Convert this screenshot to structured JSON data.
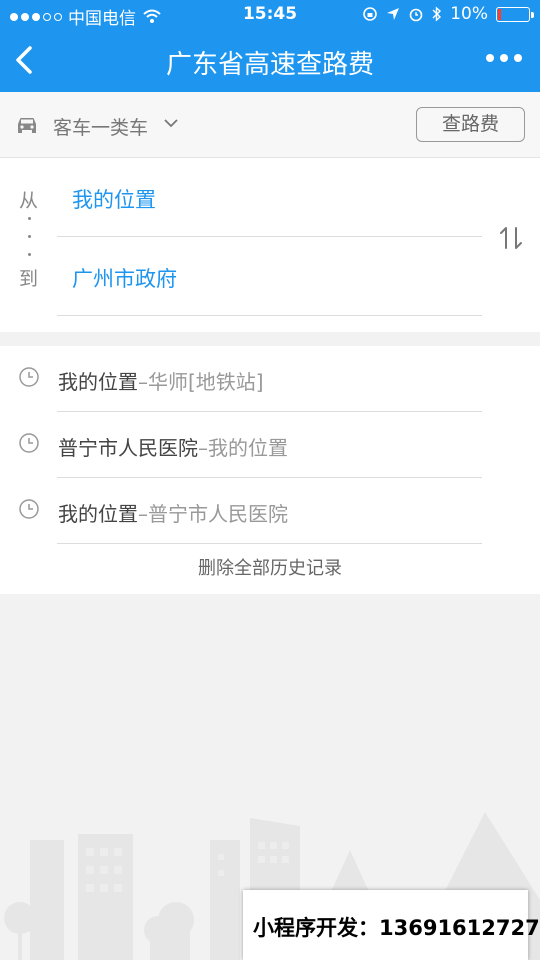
{
  "status_bar": {
    "carrier": "中国电信",
    "time": "15:45",
    "battery": "10%",
    "battery_level": 0.1,
    "signal_dots_filled": 3,
    "signal_dots_total": 5
  },
  "navbar": {
    "title": "广东省高速查路费",
    "background_color": "#1e96f0"
  },
  "vehicle": {
    "type_label": "客车一类车",
    "query_button": "查路费"
  },
  "route": {
    "from_label": "从",
    "to_label": "到",
    "from_value": "我的位置",
    "to_value": "广州市政府",
    "accent_color": "#1e96f0"
  },
  "history": {
    "items": [
      {
        "from": "我的位置",
        "separator": "–",
        "to": "华师[地铁站]"
      },
      {
        "from": "普宁市人民医院",
        "separator": "–",
        "to": "我的位置"
      },
      {
        "from": "我的位置",
        "separator": "–",
        "to": "普宁市人民医院"
      }
    ],
    "clear_label": "删除全部历史记录"
  },
  "watermark": {
    "text": "小程序开发：13691612727"
  },
  "icons": {
    "back": "chevron-left-icon",
    "more": "more-dots-icon",
    "car": "car-icon",
    "dropdown": "chevron-down-icon",
    "swap": "swap-vertical-icon",
    "history": "clock-icon"
  }
}
